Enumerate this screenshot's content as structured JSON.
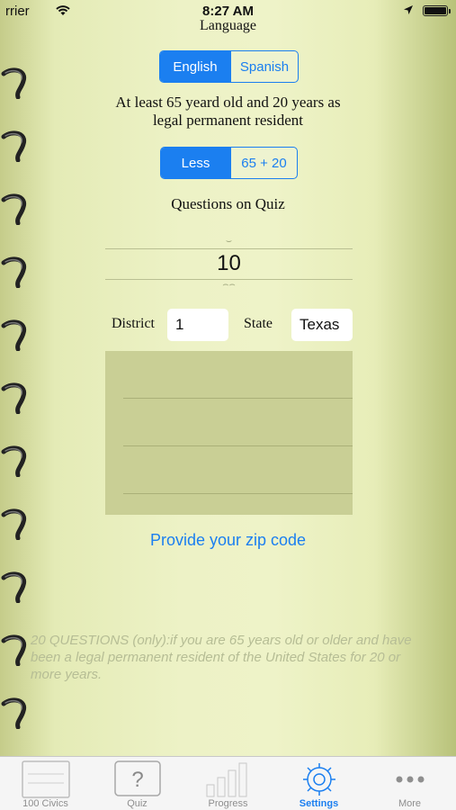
{
  "status_bar": {
    "carrier": "rrier",
    "time": "8:27 AM"
  },
  "language": {
    "title": "Language",
    "options": [
      "English",
      "Spanish"
    ],
    "selected": "English"
  },
  "age_rule": {
    "text_line1": "At least 65 yeard old and 20 years as",
    "text_line2": "legal permanent resident",
    "options": [
      "Less",
      "65 + 20"
    ],
    "selected": "Less"
  },
  "quiz": {
    "label": "Questions on Quiz",
    "value": "10"
  },
  "location": {
    "district_label": "District",
    "district_value": "1",
    "state_label": "State",
    "state_value": "Texas"
  },
  "zip_link": "Provide your zip code",
  "footnote": "20 QUESTIONS (only):if you are 65 years old or older and have been a legal permanent resident of the United States for 20 or more years.",
  "tabs": [
    {
      "label": "100 Civics",
      "icon": "notebook-icon",
      "active": false
    },
    {
      "label": "Quiz",
      "icon": "question-icon",
      "active": false
    },
    {
      "label": "Progress",
      "icon": "bar-chart-icon",
      "active": false
    },
    {
      "label": "Settings",
      "icon": "gear-icon",
      "active": true
    },
    {
      "label": "More",
      "icon": "more-dots-icon",
      "active": false
    }
  ],
  "colors": {
    "accent": "#1b7ff0",
    "background": "#eef3c8"
  }
}
